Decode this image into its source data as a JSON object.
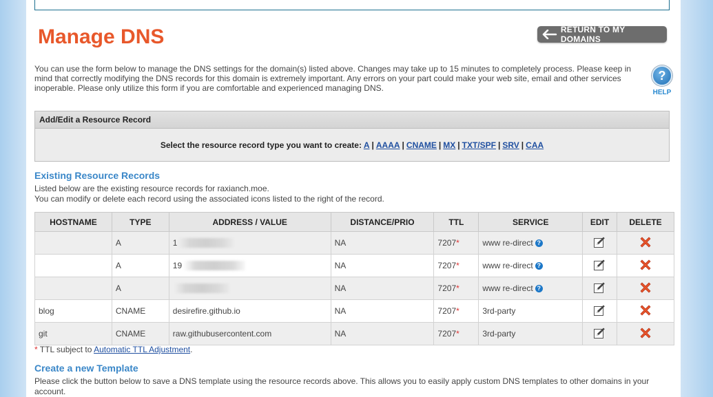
{
  "page": {
    "title": "Manage DNS",
    "return_button": "RETURN TO MY DOMAINS",
    "intro": "You can use the form below to manage the DNS settings for the domain(s) listed above. Changes may take up to 15 minutes to completely process. Please keep in mind that correctly modifying the DNS records for this domain is extremely important. Any errors on your part could make your web site, email and other services inoperable. Please only utilize this form if you are comfortable and experienced managing DNS.",
    "help_label": "HELP",
    "help_glyph": "?"
  },
  "add_panel": {
    "header": "Add/Edit a Resource Record",
    "prompt": "Select the resource record type you want to create:",
    "types": [
      "A",
      "AAAA",
      "CNAME",
      "MX",
      "TXT/SPF",
      "SRV",
      "CAA"
    ]
  },
  "existing": {
    "title": "Existing Resource Records",
    "line1": "Listed below are the existing resource records for raxianch.moe.",
    "line2": "You can modify or delete each record using the associated icons listed to the right of the record.",
    "columns": [
      "HOSTNAME",
      "TYPE",
      "ADDRESS / VALUE",
      "DISTANCE/PRIO",
      "TTL",
      "SERVICE",
      "EDIT",
      "DELETE"
    ],
    "rows": [
      {
        "host": "",
        "type": "A",
        "value": "1",
        "prio": "NA",
        "ttl": "7207",
        "service": "www re-direct",
        "help": true
      },
      {
        "host": "",
        "type": "A",
        "value": "19",
        "prio": "NA",
        "ttl": "7207",
        "service": "www re-direct",
        "help": true
      },
      {
        "host": "",
        "type": "A",
        "value": "",
        "prio": "NA",
        "ttl": "7207",
        "service": "www re-direct",
        "help": true
      },
      {
        "host": "blog",
        "type": "CNAME",
        "value": "desirefire.github.io",
        "prio": "NA",
        "ttl": "7207",
        "service": "3rd-party",
        "help": false
      },
      {
        "host": "git",
        "type": "CNAME",
        "value": "raw.githubusercontent.com",
        "prio": "NA",
        "ttl": "7207",
        "service": "3rd-party",
        "help": false
      }
    ]
  },
  "footnote": {
    "star": "*",
    "text": "TTL subject to",
    "link": "Automatic TTL Adjustment",
    "end": "."
  },
  "template": {
    "title": "Create a new Template",
    "text": "Please click the button below to save a DNS template using the resource records above. This allows you to easily apply custom DNS templates to other domains in your account."
  },
  "colors": {
    "title": "#e8582b",
    "section": "#3a87c8",
    "link": "#1f4fa0",
    "delete": "#e8542a"
  },
  "icons": {
    "return": "left-arrow-icon",
    "help": "help-icon",
    "edit": "edit-pencil-icon",
    "delete": "delete-x-icon"
  }
}
